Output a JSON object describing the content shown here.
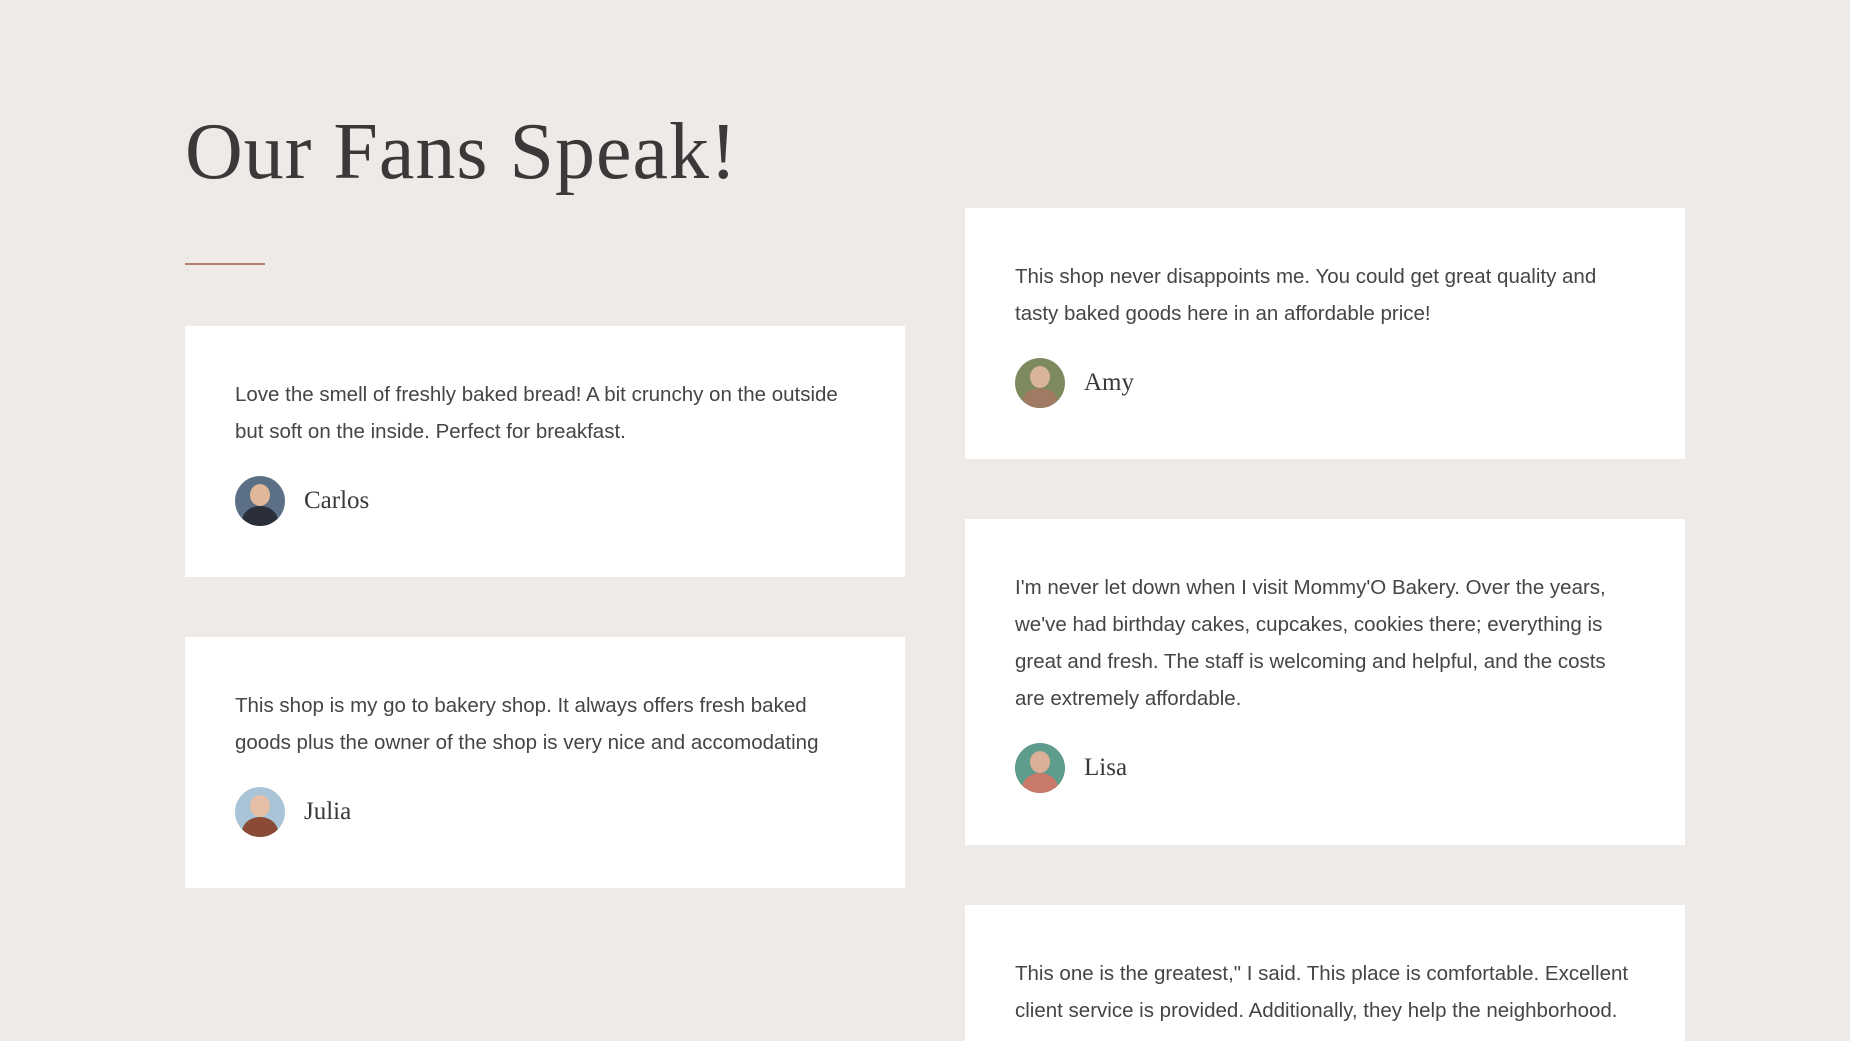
{
  "section": {
    "title": "Our Fans Speak!",
    "accent_color": "#b7816c",
    "background_color": "#eeeae7"
  },
  "testimonials": [
    {
      "quote": "Love the smell of freshly baked bread! A bit crunchy on the outside but soft on the inside. Perfect for breakfast.",
      "author": "Carlos",
      "avatar_icon": "avatar-man-sunglasses",
      "avatar_colors": [
        "#5b6f86",
        "#2b2f3a"
      ]
    },
    {
      "quote": "This shop is my go to bakery shop. It always offers fresh baked goods plus the owner of the shop is very nice and accomodating",
      "author": "Julia",
      "avatar_icon": "avatar-woman-redhead",
      "avatar_colors": [
        "#a9c4d6",
        "#8a4a36"
      ]
    },
    {
      "quote": "This shop never disappoints me. You could get great quality and tasty baked goods here in an affordable price!",
      "author": "Amy",
      "avatar_icon": "avatar-woman-outdoor",
      "avatar_colors": [
        "#7c8a5d",
        "#a07a62"
      ]
    },
    {
      "quote": "I'm never let down when I visit Mommy'O Bakery. Over the years, we've had birthday cakes, cupcakes, cookies there; everything is great and fresh. The staff is welcoming and helpful, and the costs are extremely affordable.",
      "author": "Lisa",
      "avatar_icon": "avatar-woman-cup",
      "avatar_colors": [
        "#5e9c8c",
        "#c97a6a"
      ]
    },
    {
      "quote": "This one is the greatest,\" I said. This place is comfortable. Excellent client service is provided. Additionally, they help the neighborhood.",
      "author": "",
      "avatar_icon": "",
      "avatar_colors": [
        "#cccccc",
        "#999999"
      ]
    }
  ]
}
